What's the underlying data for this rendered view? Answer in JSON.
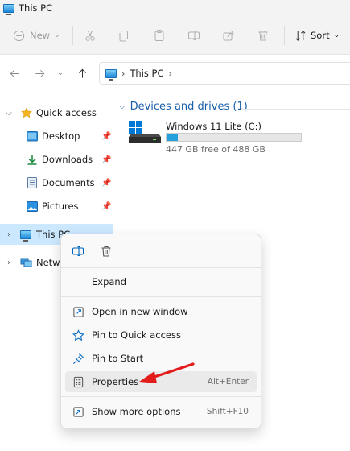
{
  "window": {
    "title": "This PC"
  },
  "toolbar": {
    "new_label": "New",
    "sort_label": "Sort"
  },
  "address": {
    "location": "This PC"
  },
  "sidebar": {
    "quick_access": "Quick access",
    "items": [
      {
        "label": "Desktop"
      },
      {
        "label": "Downloads"
      },
      {
        "label": "Documents"
      },
      {
        "label": "Pictures"
      }
    ],
    "this_pc": "This PC",
    "network": "Netwo"
  },
  "main": {
    "group_label": "Devices and drives (1)",
    "drive": {
      "name": "Windows 11 Lite (C:)",
      "free_text": "447 GB free of 488 GB",
      "used_fraction": 0.084
    }
  },
  "context_menu": {
    "expand": "Expand",
    "items": [
      {
        "label": "Open in new window",
        "shortcut": ""
      },
      {
        "label": "Pin to Quick access",
        "shortcut": ""
      },
      {
        "label": "Pin to Start",
        "shortcut": ""
      },
      {
        "label": "Properties",
        "shortcut": "Alt+Enter"
      }
    ],
    "more": {
      "label": "Show more options",
      "shortcut": "Shift+F10"
    }
  },
  "colors": {
    "accent": "#0067c0",
    "selection": "#cce8ff",
    "drive_fill": "#26a0da",
    "arrow": "#e21b1b",
    "group_text": "#1b5fa8"
  }
}
